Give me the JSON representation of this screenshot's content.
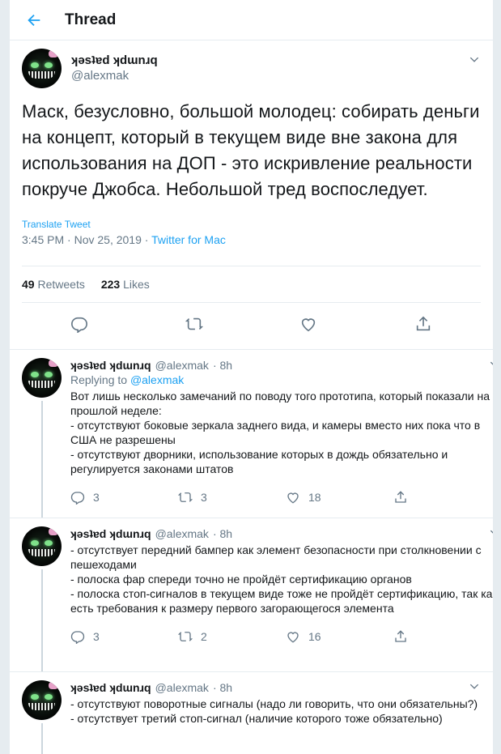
{
  "header": {
    "title": "Thread"
  },
  "main_tweet": {
    "display_name": "ʞəsʇɐd ʞdɯnɹq",
    "handle": "@alexmak",
    "text": "Маск, безусловно, большой молодец: собирать деньги на концепт, который в текущем виде вне закона для использования на ДОП - это искривление реальности покруче Джобса. Небольшой тред воспоследует.",
    "translate": "Translate Tweet",
    "timestamp": "3:45 PM · Nov 25, 2019 · ",
    "app": "Twitter for Mac",
    "retweets_count": "49",
    "retweets_label": "Retweets",
    "likes_count": "223",
    "likes_label": "Likes"
  },
  "replies": [
    {
      "display_name": "ʞəsʇɐd ʞdɯnɹq",
      "handle": "@alexmak",
      "age": "· 8h",
      "replying_prefix": "Replying to ",
      "replying_handle": "@alexmak",
      "text": "Вот лишь несколько замечаний по поводу того прототипа, который показали на прошлой неделе:\n- отсутствуют боковые зеркала заднего вида, и камеры вместо них пока что в США не разрешены\n- отсутствуют дворники, использование которых в дождь обязательно и регулируется законами штатов",
      "replies": "3",
      "retweets": "3",
      "likes": "18"
    },
    {
      "display_name": "ʞəsʇɐd ʞdɯnɹq",
      "handle": "@alexmak",
      "age": "· 8h",
      "text": "- отсутствует передний бампер как элемент безопасности при столкновении с пешеходами\n- полоска фар спереди точно не пройдёт сертификацию органов\n- полоска стоп-сигналов в текущем виде тоже не пройдёт сертификацию, так как есть требования к размеру первого загорающегося элемента",
      "replies": "3",
      "retweets": "2",
      "likes": "16"
    },
    {
      "display_name": "ʞəsʇɐd ʞdɯnɹq",
      "handle": "@alexmak",
      "age": "· 8h",
      "text": "- отсутствуют поворотные сигналы (надо ли говорить, что они обязательны?)\n- отсутствует третий стоп-сигнал (наличие которого тоже обязательно)"
    }
  ],
  "colors": {
    "accent": "#1da1f2",
    "muted": "#657786",
    "border": "#e6ecf0"
  }
}
